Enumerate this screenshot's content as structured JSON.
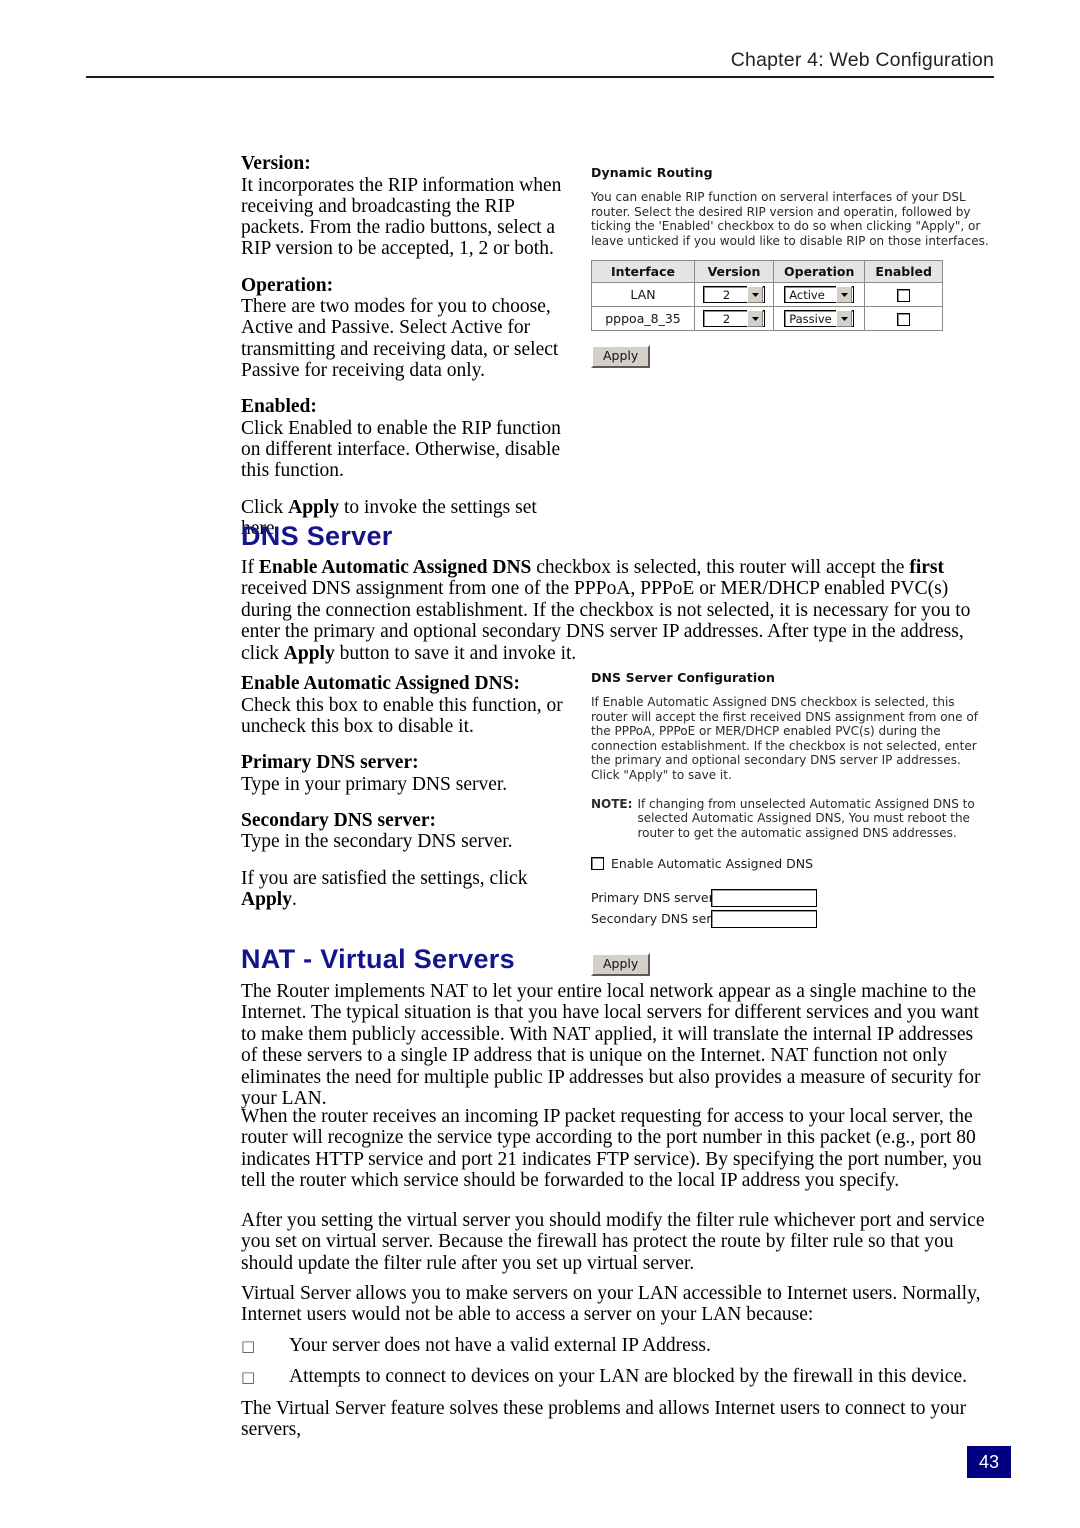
{
  "header": {
    "chapter_text": "Chapter 4: Web Configuration"
  },
  "page": {
    "number": "43"
  },
  "left_column": {
    "version_term": "Version:",
    "version_body": "It incorporates the RIP information when receiving and broadcasting the RIP packets. From the radio buttons, select a RIP version to be accepted, 1, 2 or both.",
    "operation_term": "Operation:",
    "operation_body": "There are two modes for you to choose, Active and Passive. Select Active for transmitting and receiving data, or select Passive for receiving data only.",
    "enabled_term": "Enabled:",
    "enabled_body": "Click Enabled to enable the RIP function on different interface. Otherwise, disable this function.",
    "apply_note_pre": "Click ",
    "apply_note_bold": "Apply",
    "apply_note_post": " to invoke the settings set here."
  },
  "dns_section": {
    "heading": "DNS Server",
    "intro_part1": "If ",
    "intro_bold1": "Enable Automatic Assigned DNS",
    "intro_part2": " checkbox is selected, this router will accept the ",
    "intro_bold2": "first",
    "intro_part3": " received DNS assignment from one of the PPPoA, PPPoE or MER/DHCP enabled PVC(s) during the connection establishment. If the checkbox is not selected, it is necessary for you to enter the primary and optional secondary DNS server IP addresses. After type in the address, click ",
    "intro_bold3": "Apply",
    "intro_part4": " button to save it and invoke it.",
    "enable_term": "Enable Automatic Assigned DNS:",
    "enable_body": "Check this box to enable this function, or uncheck this box to disable it.",
    "primary_term": "Primary DNS server:",
    "primary_body": "Type in your primary DNS server.",
    "secondary_term": "Secondary DNS server:",
    "secondary_body": "Type in the secondary DNS server.",
    "satisfied_pre": "If you are satisfied the settings, click ",
    "satisfied_bold": "Apply",
    "satisfied_post": "."
  },
  "nat_section": {
    "heading": "NAT - Virtual Servers",
    "para1": "The Router implements NAT to let your entire local network appear as a single machine to the Internet. The typical situation is that you have local servers for different services and you want to make them publicly accessible. With NAT applied, it will translate the internal IP addresses of these servers to a single IP address that is unique on the Internet. NAT function not only eliminates the need for multiple public IP addresses but also provides a measure of security for your LAN.",
    "para2": "When the router receives an incoming IP packet requesting for access to your local server, the router will recognize the service type according to the port number in this packet (e.g., port 80 indicates HTTP service and port 21 indicates FTP service). By specifying the port number, you tell the router which service should be forwarded to the local IP address you specify.",
    "para3": "After you setting the virtual server you should modify the filter rule whichever port and service you set on virtual server. Because the firewall has protect the route by filter rule so that you should update the filter rule after you set up virtual server.",
    "para4": "Virtual Server allows you to make servers on your LAN accessible to Internet users. Normally, Internet users would not be able to access a server on your LAN because:",
    "bullets": [
      "Your server does not have a valid external IP Address.",
      "Attempts to connect to devices on your LAN are blocked by the firewall in this device."
    ],
    "bullet_marker": "□",
    "para5": "The Virtual Server feature solves these problems and allows Internet users to connect to your servers,"
  },
  "figure_dynamic_routing": {
    "title": "Dynamic Routing",
    "description": "You can enable RIP function on serveral interfaces of your DSL router. Select the desired RIP version and operatin, followed by ticking the 'Enabled' checkbox to do so when clicking \"Apply\", or leave unticked if you would like to disable RIP on those interfaces.",
    "table": {
      "headers": [
        "Interface",
        "Version",
        "Operation",
        "Enabled"
      ],
      "rows": [
        {
          "interface": "LAN",
          "version": "2",
          "operation": "Active",
          "enabled": false
        },
        {
          "interface": "pppoa_8_35",
          "version": "2",
          "operation": "Passive",
          "enabled": false
        }
      ]
    },
    "apply_label": "Apply"
  },
  "figure_dns_config": {
    "title": "DNS Server Configuration",
    "description": "If Enable Automatic Assigned DNS checkbox is selected, this router will accept the first received DNS assignment from one of the PPPoA, PPPoE or MER/DHCP enabled PVC(s) during the connection establishment. If the checkbox is not selected, enter the primary and optional secondary DNS server IP addresses. Click \"Apply\" to save it.",
    "note_label": "NOTE:",
    "note_text": "If changing from unselected Automatic Assigned DNS to selected Automatic Assigned DNS, You must reboot the router to get the automatic assigned DNS addresses.",
    "checkbox_label": "Enable Automatic Assigned DNS",
    "checkbox_checked": false,
    "primary_label": "Primary DNS server:",
    "primary_value": "",
    "secondary_label": "Secondary DNS server:",
    "secondary_value": "",
    "apply_label": "Apply"
  }
}
